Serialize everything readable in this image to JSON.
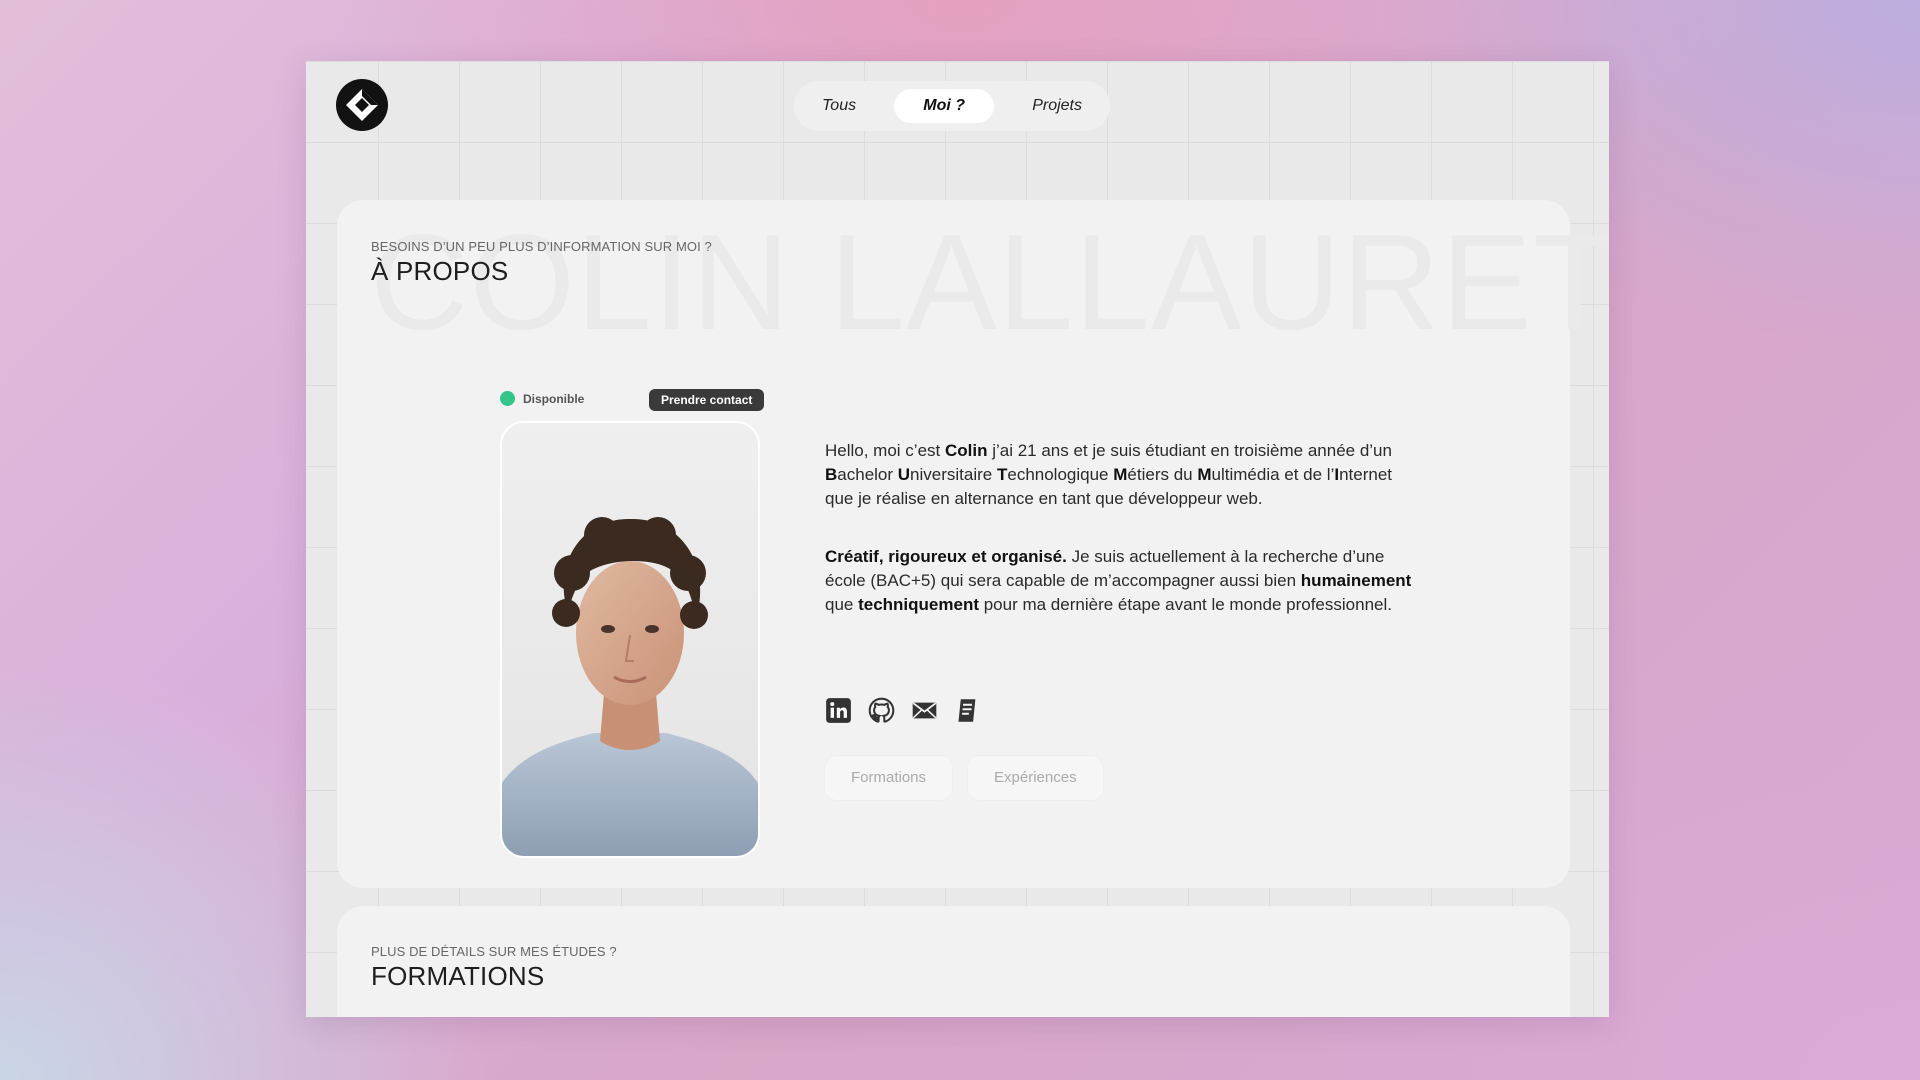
{
  "nav": {
    "items": [
      "Tous",
      "Moi ?",
      "Projets"
    ],
    "active_index": 1
  },
  "about": {
    "watermark": "COLIN LALLAURET",
    "eyebrow": "Besoins d’un peu plus d’information sur moi ?",
    "heading": "À propos",
    "status_label": "Disponible",
    "status_color": "#35c48a",
    "contact_label": "Prendre contact",
    "bio_html_1": "Hello, moi c’est <b>Colin</b> j’ai 21 ans et je suis étudiant en troisième année d’un <b>B</b>achelor <b>U</b>niversitaire <b>T</b>echnologique <b>M</b>étiers du <b>M</b>ultimédia et de l’<b>I</b>nternet que je réalise en alternance en tant que développeur web.",
    "bio_html_2": "<b>Créatif, rigoureux et organisé.</b> Je suis actuellement à la recherche d’une école (BAC+5) qui sera capable de m’accompagner aussi bien <b>humainement</b> que <b>techniquement</b> pour ma dernière étape avant le monde professionnel.",
    "socials": [
      "linkedin-icon",
      "github-icon",
      "mail-icon",
      "document-icon"
    ],
    "buttons": [
      "Formations",
      "Expériences"
    ]
  },
  "formations": {
    "eyebrow": "Plus de détails sur mes études ?",
    "heading": "Formations"
  },
  "colors": {
    "accent": "#3a3a3a",
    "available": "#35c48a"
  }
}
